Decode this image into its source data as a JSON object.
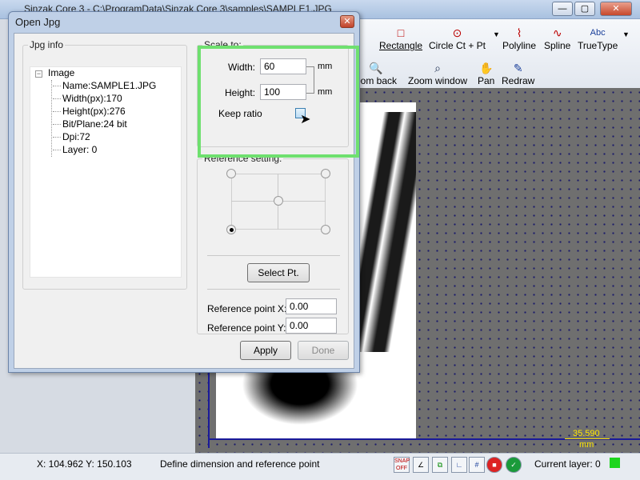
{
  "app": {
    "title": "Sinzak Core 3 - C:\\ProgramData\\Sinzak Core 3\\samples\\SAMPLE1.JPG"
  },
  "toolbar": {
    "rectangle": "Rectangle",
    "circle": "Circle Ct + Pt",
    "polyline": "Polyline",
    "spline": "Spline",
    "truetype": "TrueType",
    "truetype_icon": "Abc",
    "zoom_back": "oom back",
    "zoom_window": "Zoom window",
    "pan": "Pan",
    "redraw": "Redraw"
  },
  "canvas": {
    "scale_value": "35.590",
    "scale_unit": "mm"
  },
  "dialog": {
    "title": "Open Jpg",
    "jpg_info": {
      "title": "Jpg info",
      "root": "Image",
      "items": [
        "Name:SAMPLE1.JPG",
        "Width(px):170",
        "Height(px):276",
        "Bit/Plane:24 bit",
        "Dpi:72",
        "Layer: 0"
      ]
    },
    "scale": {
      "title": "Scale to:",
      "width_label": "Width:",
      "width_value": "60",
      "height_label": "Height:",
      "height_value": "100",
      "unit": "mm",
      "keep_ratio_label": "Keep ratio"
    },
    "reference": {
      "title": "Reference setting:",
      "select_pt": "Select Pt.",
      "x_label": "Reference point X:",
      "x_value": "0.00",
      "y_label": "Reference point Y:",
      "y_value": "0.00"
    },
    "apply": "Apply",
    "done": "Done"
  },
  "statusbar": {
    "coords": "X: 104.962 Y: 150.103",
    "message": "Define dimension and reference point",
    "snap": "SNAP OFF",
    "layer": "Current layer: 0"
  },
  "colors": {
    "highlight": "#6fe06f",
    "layer_indicator": "#1ed51e",
    "scale_bar": "#ffe600"
  }
}
